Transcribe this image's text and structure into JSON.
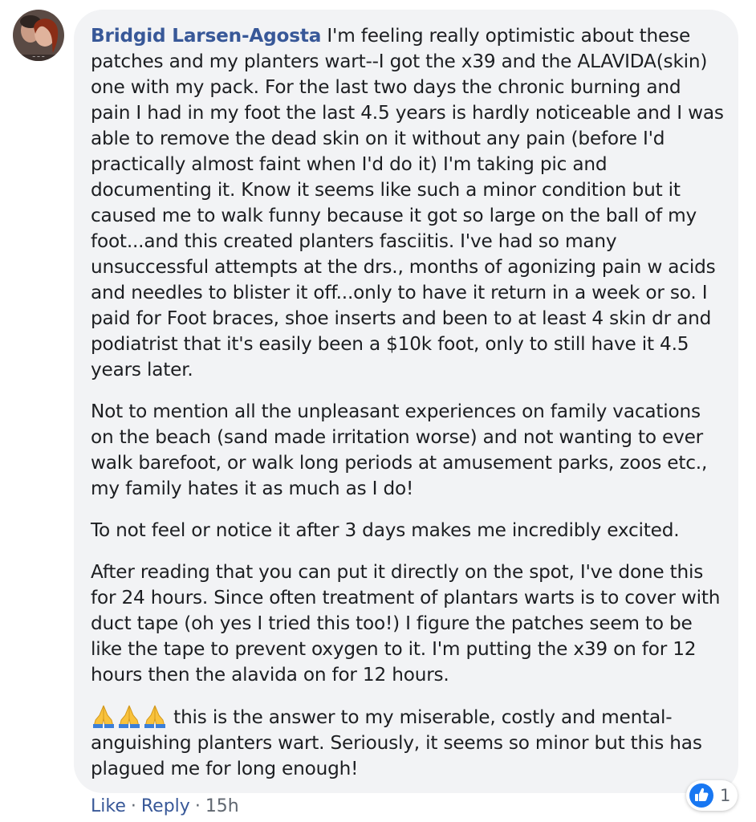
{
  "comment": {
    "author": "Bridgid Larsen-Agosta",
    "paragraphs": [
      "I'm feeling really optimistic about these patches and my planters wart--I got the x39 and the ALAVIDA(skin) one with my pack. For the last two days the chronic burning and pain I had in my foot the last 4.5 years is hardly noticeable and I was able to remove the dead skin on it without any pain (before I'd practically almost faint when I'd do it) I'm taking pic and documenting it. Know it seems like such a minor condition but it caused me to walk funny because it got so large on the ball of my foot...and this created planters fasciitis. I've had so many unsuccessful attempts at the drs., months of agonizing pain w acids and needles to blister it off...only to have it return in a week or so. I paid for Foot braces, shoe inserts and been to at least 4 skin dr and podiatrist that it's easily been a $10k foot, only to still have it 4.5 years later.",
      "Not to mention all the unpleasant experiences on family vacations on the beach (sand made irritation worse) and not wanting to ever walk barefoot, or walk long periods at amusement parks, zoos etc., my family hates it as much as I do!",
      "To not feel or notice it after 3 days makes me incredibly excited.",
      "After reading that you can put it directly on the spot, I've done this for 24 hours. Since often treatment of plantars warts is to cover with duct tape (oh yes I tried this too!) I figure the patches seem to be like the tape to prevent oxygen to it. I'm putting the x39 on for 12 hours then the alavida on for 12 hours.",
      "this is the answer to my miserable, costly and mental-anguishing planters wart. Seriously, it seems so minor but this has plagued me for long enough!"
    ],
    "emoji": [
      "folded-hands-icon",
      "folded-hands-icon",
      "folded-hands-icon"
    ]
  },
  "actions": {
    "like_label": "Like",
    "separator": "·",
    "reply_label": "Reply",
    "timestamp": "15h"
  },
  "reactions": {
    "icon": "thumbs-up-icon",
    "count": "1"
  },
  "colors": {
    "author": "#385898",
    "bubble": "#f2f3f5",
    "text": "#1c1e21",
    "like_blue": "#1877f2"
  }
}
